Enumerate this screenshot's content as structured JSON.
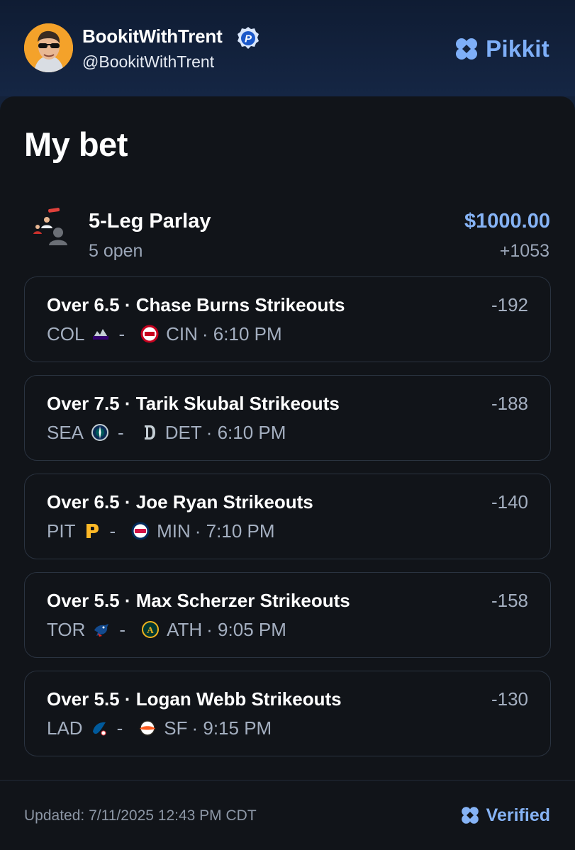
{
  "header": {
    "username": "BookitWithTrent",
    "handle": "@BookitWithTrent",
    "brand": "Pikkit",
    "badge_icon": "pikkit-p-badge-icon",
    "avatar_icon": "avatar-sunglasses"
  },
  "bet": {
    "title": "My bet",
    "parlay_name": "5-Leg Parlay",
    "open_status": "5 open",
    "stake": "$1000.00",
    "odds": "+1053",
    "legs": [
      {
        "title": "Over 6.5 · Chase Burns Strikeouts",
        "odds": "-192",
        "away": "COL",
        "home": "CIN",
        "time": "· 6:10 PM",
        "away_logo": "rockies-logo",
        "home_logo": "reds-logo"
      },
      {
        "title": "Over 7.5 · Tarik Skubal Strikeouts",
        "odds": "-188",
        "away": "SEA",
        "home": "DET",
        "time": "· 6:10 PM",
        "away_logo": "mariners-logo",
        "home_logo": "tigers-logo"
      },
      {
        "title": "Over 6.5 · Joe Ryan Strikeouts",
        "odds": "-140",
        "away": "PIT",
        "home": "MIN",
        "time": "· 7:10 PM",
        "away_logo": "pirates-logo",
        "home_logo": "twins-logo"
      },
      {
        "title": "Over 5.5 · Max Scherzer Strikeouts",
        "odds": "-158",
        "away": "TOR",
        "home": "ATH",
        "time": "· 9:05 PM",
        "away_logo": "bluejays-logo",
        "home_logo": "athletics-logo"
      },
      {
        "title": "Over 5.5 · Logan Webb Strikeouts",
        "odds": "-130",
        "away": "LAD",
        "home": "SF",
        "time": "· 9:15 PM",
        "away_logo": "dodgers-logo",
        "home_logo": "giants-logo"
      }
    ],
    "separator": "-"
  },
  "footer": {
    "updated": "Updated: 7/11/2025 12:43 PM CDT",
    "verified": "Verified"
  },
  "colors": {
    "accent": "#86b3f5",
    "header_bg": "#14223a",
    "card_bg": "#111419",
    "muted": "#a4afc0"
  }
}
